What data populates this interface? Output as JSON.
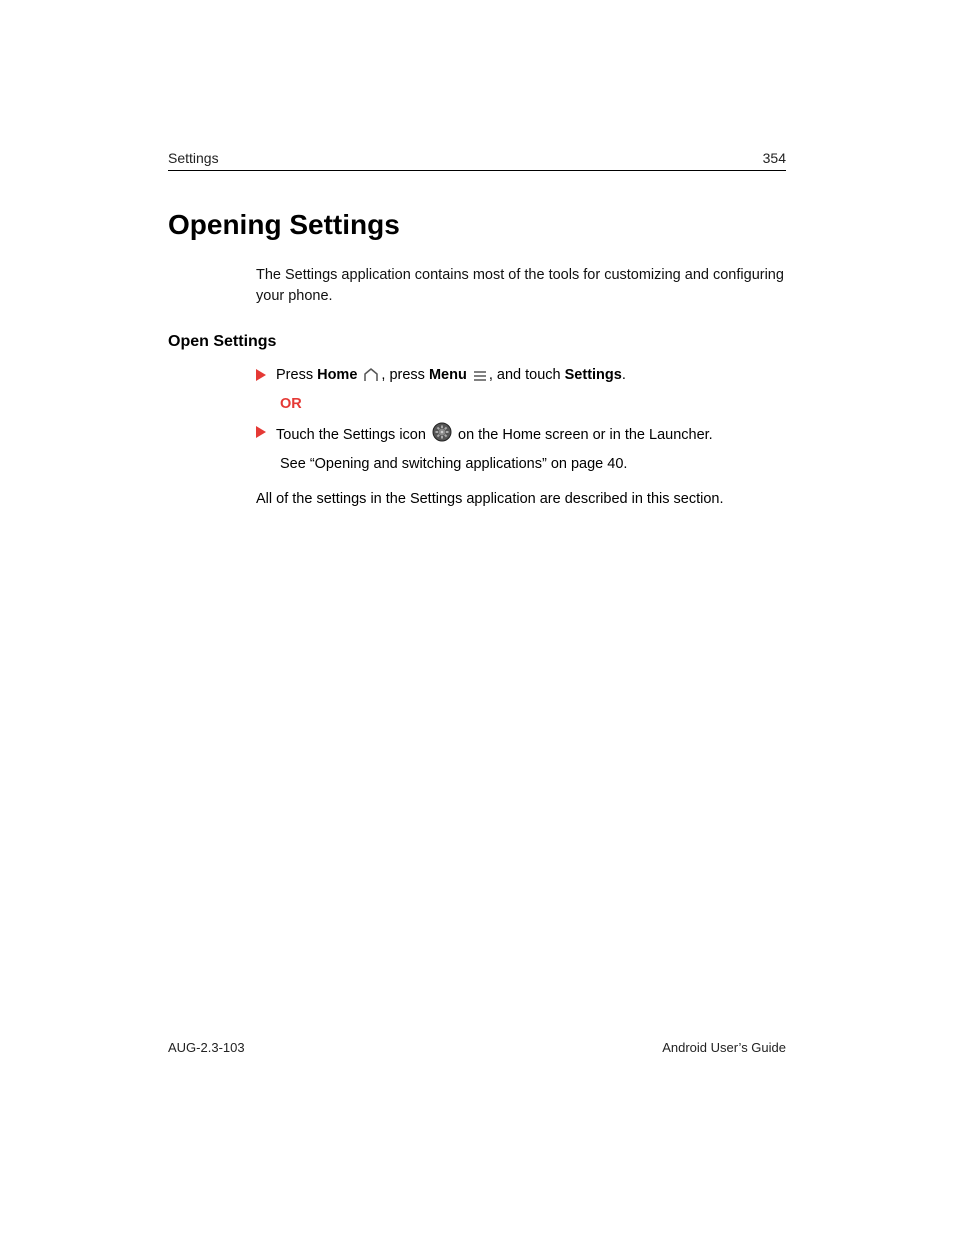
{
  "header": {
    "section": "Settings",
    "page_number": "354"
  },
  "title": "Opening Settings",
  "intro": "The Settings application contains most of the tools for customizing and configuring your phone.",
  "subhead": "Open Settings",
  "step1": {
    "t1": "Press ",
    "home": "Home",
    "t2": ", press ",
    "menu": "Menu",
    "t3": ", and touch ",
    "settings": "Settings",
    "t4": "."
  },
  "or": "OR",
  "step2": {
    "t1": "Touch the Settings icon ",
    "t2": " on the Home screen or in the Launcher."
  },
  "see_line": "See “Opening and switching applications” on page 40.",
  "closing": "All of the settings in the Settings application are described in this section.",
  "footer": {
    "left": "AUG-2.3-103",
    "right": "Android User’s Guide"
  }
}
